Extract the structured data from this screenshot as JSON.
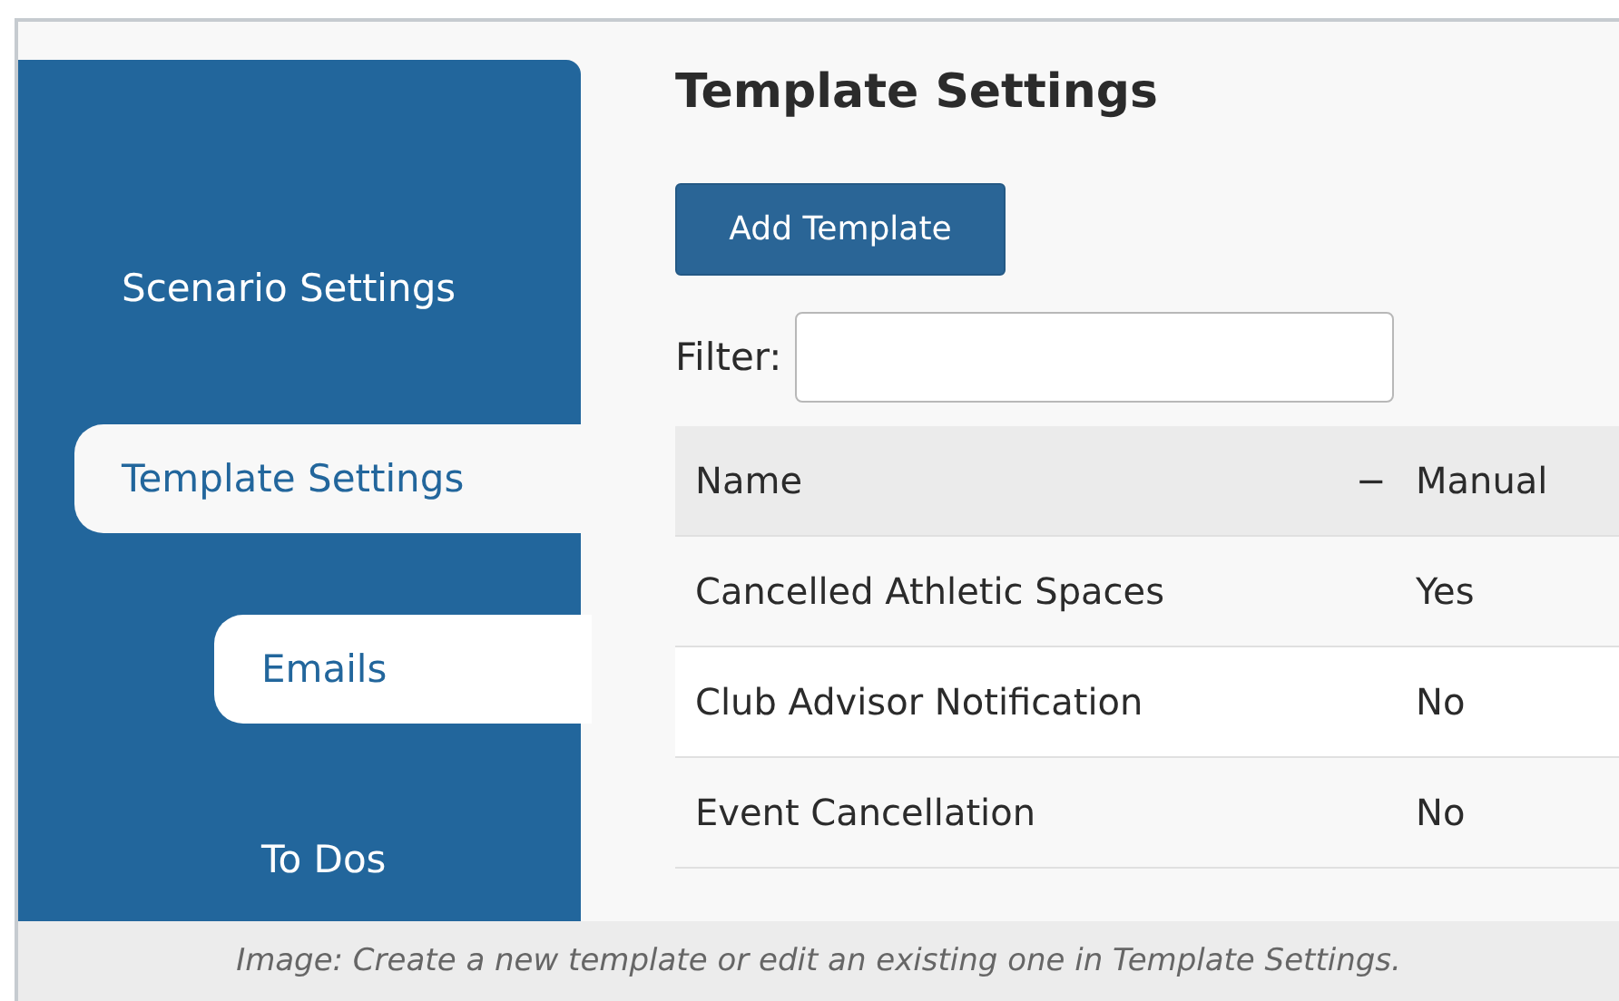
{
  "sidebar": {
    "items": [
      {
        "label": "Scenario Settings",
        "selected": false
      },
      {
        "label": "Template Settings",
        "selected": true,
        "expanded": true,
        "children": [
          {
            "label": "Emails",
            "selected": true
          },
          {
            "label": "To Dos",
            "selected": false
          }
        ]
      }
    ]
  },
  "page_title": "Template Settings",
  "add_button": "Add Template",
  "filter": {
    "label": "Filter:"
  },
  "table": {
    "columns": [
      {
        "label": "Name"
      },
      {
        "label": "Manual",
        "sort_icon": "−"
      }
    ],
    "rows": [
      [
        "Cancelled Athletic Spaces",
        "Yes"
      ],
      [
        "Club Advisor Notification",
        "No"
      ],
      [
        "Event Cancellation",
        "No"
      ]
    ]
  },
  "caption": "Image: Create a new template or edit an existing one in Template Settings."
}
